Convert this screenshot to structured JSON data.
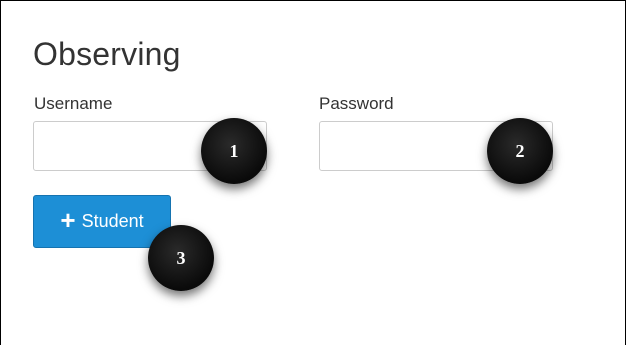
{
  "page": {
    "title": "Observing"
  },
  "form": {
    "username_label": "Username",
    "username_value": "",
    "password_label": "Password",
    "password_value": "",
    "add_student_button": {
      "icon": "plus-icon",
      "icon_glyph": "+",
      "label": "Student"
    }
  },
  "callouts": [
    "1",
    "2",
    "3"
  ],
  "colors": {
    "button_bg": "#1d8fd6",
    "callout_bg": "#111111"
  }
}
